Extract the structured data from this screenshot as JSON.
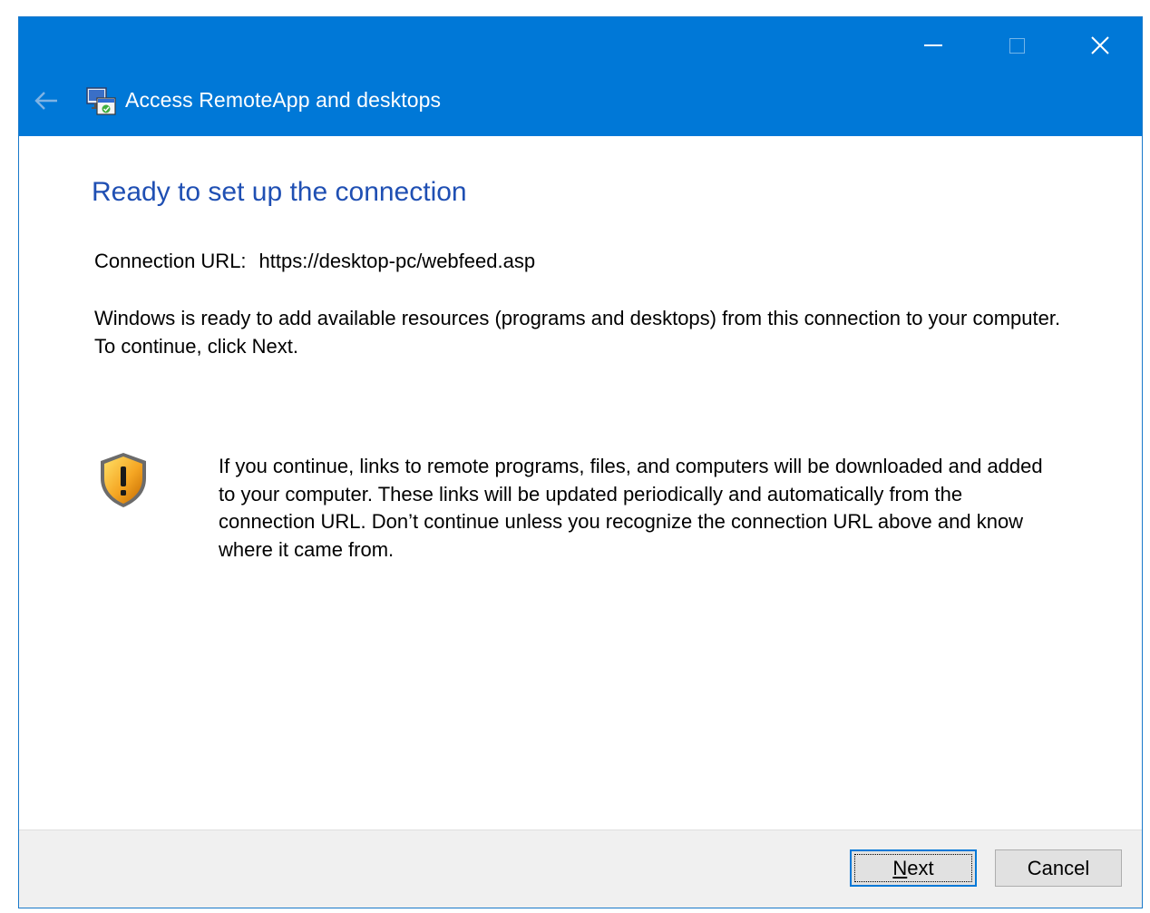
{
  "window": {
    "title": "Access RemoteApp and desktops",
    "accent_color": "#0078d7",
    "caption_buttons": [
      "minimize-icon",
      "maximize-icon",
      "close-icon"
    ]
  },
  "content": {
    "heading": "Ready to set up the connection",
    "url_label": "Connection URL:",
    "url_value": "https://desktop-pc/webfeed.asp",
    "description": "Windows is ready to add available resources (programs and desktops) from this connection to your computer. To continue, click Next.",
    "warning_icon": "shield-warning-icon",
    "warning_text": "If you continue, links to remote programs, files, and computers will be downloaded and added to your computer.  These links will be updated periodically and automatically from the connection URL. Don’t continue unless you recognize the connection URL above and know where it came from."
  },
  "footer": {
    "next_rest": "ext",
    "next_access_key": "N",
    "cancel_label": "Cancel"
  }
}
